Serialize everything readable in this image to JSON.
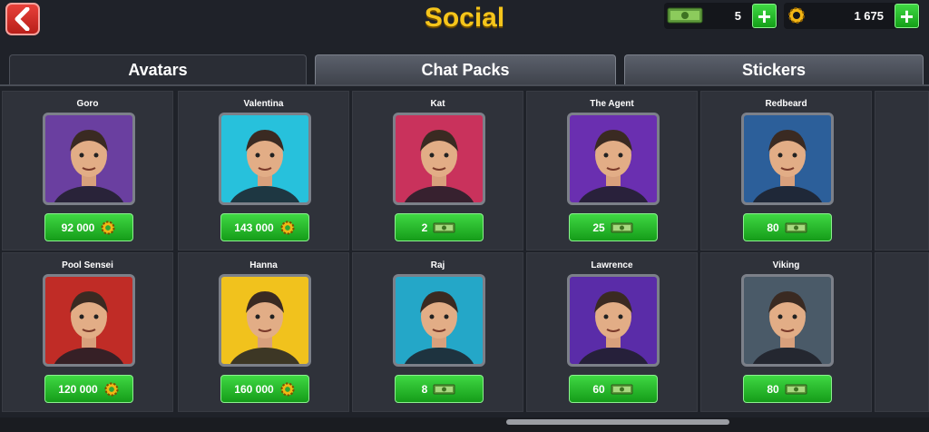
{
  "header": {
    "title": "Social"
  },
  "currency": {
    "cash": {
      "value": "5"
    },
    "coins": {
      "value": "1 675"
    }
  },
  "tabs": [
    {
      "label": "Avatars"
    },
    {
      "label": "Chat Packs"
    },
    {
      "label": "Stickers"
    }
  ],
  "avatars": [
    {
      "name": "Goro",
      "price": "92 000",
      "currency": "coin-icon",
      "bg": "#6a3fa0"
    },
    {
      "name": "Valentina",
      "price": "143 000",
      "currency": "coin-icon",
      "bg": "#27c1dc"
    },
    {
      "name": "Kat",
      "price": "2",
      "currency": "cash-icon",
      "bg": "#c9325c"
    },
    {
      "name": "The Agent",
      "price": "25",
      "currency": "cash-icon",
      "bg": "#6a2fb0"
    },
    {
      "name": "Redbeard",
      "price": "80",
      "currency": "cash-icon",
      "bg": "#2c5f9a"
    },
    {
      "name": "Pool Sensei",
      "price": "120 000",
      "currency": "coin-icon",
      "bg": "#c02c26"
    },
    {
      "name": "Hanna",
      "price": "160 000",
      "currency": "coin-icon",
      "bg": "#f1c21d"
    },
    {
      "name": "Raj",
      "price": "8",
      "currency": "cash-icon",
      "bg": "#24a7c8"
    },
    {
      "name": "Lawrence",
      "price": "60",
      "currency": "cash-icon",
      "bg": "#5a2ca8"
    },
    {
      "name": "Viking",
      "price": "80",
      "currency": "cash-icon",
      "bg": "#4a5a68"
    }
  ]
}
